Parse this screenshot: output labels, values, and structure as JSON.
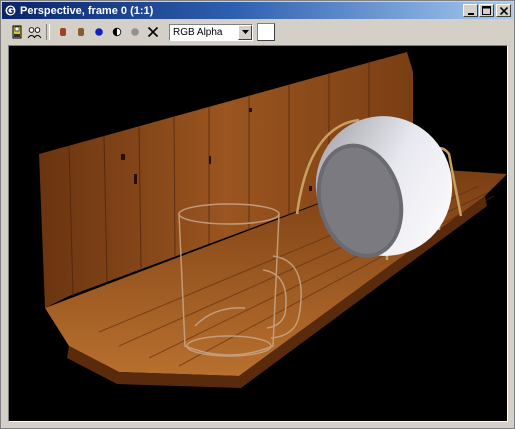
{
  "window": {
    "title": "Perspective, frame 0 (1:1)"
  },
  "title_buttons": [
    {
      "name": "minimize",
      "icon": "minimize-icon"
    },
    {
      "name": "maximize",
      "icon": "maximize-icon"
    },
    {
      "name": "close",
      "icon": "close-icon"
    }
  ],
  "toolbar": {
    "tools": [
      {
        "name": "save-image",
        "icon": "save-icon"
      },
      {
        "name": "clone-window",
        "icon": "clone-icon"
      },
      {
        "name": "red-channel",
        "icon": "red-channel-icon"
      },
      {
        "name": "green-channel",
        "icon": "green-channel-icon"
      },
      {
        "name": "blue-channel",
        "icon": "blue-channel-icon"
      },
      {
        "name": "alpha-channel",
        "icon": "alpha-channel-icon"
      },
      {
        "name": "monochrome",
        "icon": "monochrome-icon"
      },
      {
        "name": "clear",
        "icon": "clear-icon"
      }
    ],
    "channel_select": {
      "value": "RGB Alpha"
    }
  },
  "colors": {
    "title_start": "#0a246a",
    "title_end": "#a6caf0",
    "chrome": "#d4d0c8",
    "viewport_bg": "#000000",
    "wood_dark": "#5a2a0c",
    "wood_mid": "#8a4a1c",
    "wood_light": "#c27a3a"
  }
}
